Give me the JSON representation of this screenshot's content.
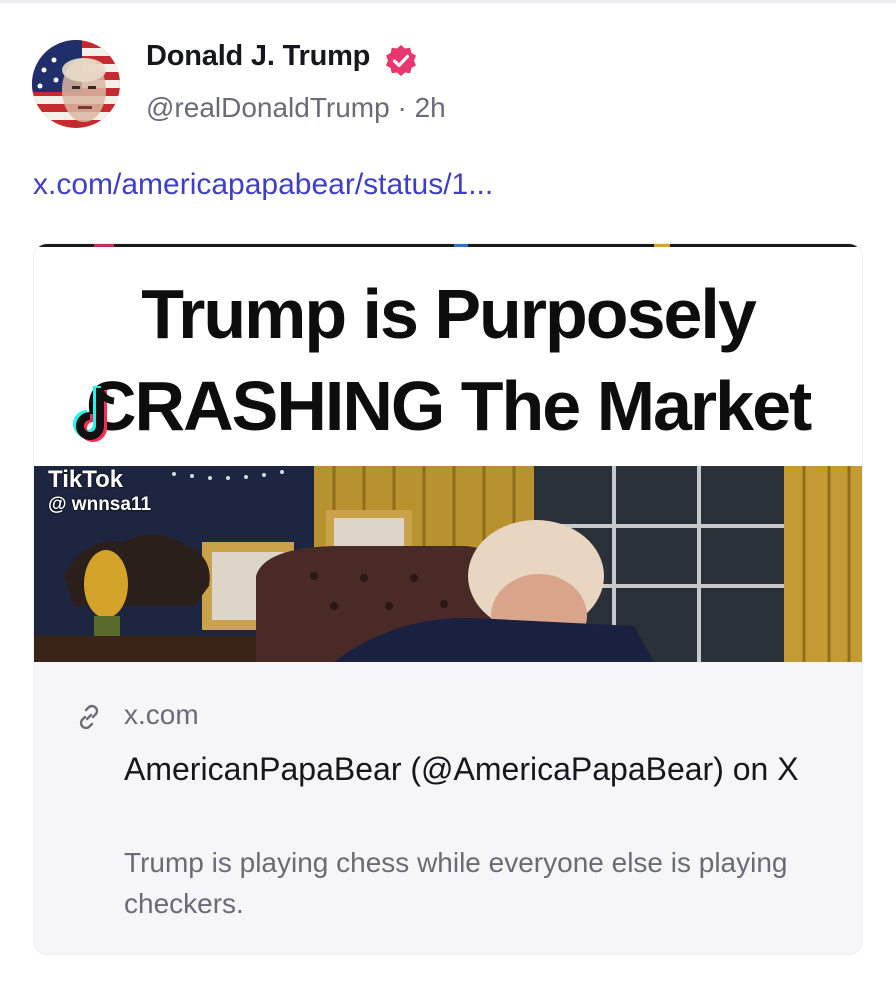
{
  "post": {
    "author": {
      "display_name": "Donald J. Trump",
      "handle": "@realDonaldTrump",
      "separator": "·",
      "time_ago": "2h",
      "verified": true
    },
    "link_text": "x.com/americapapabear/status/1...",
    "link_color": "#3d3fc4",
    "verified_color": "#e8366f"
  },
  "link_card": {
    "image": {
      "headline_line1": "Trump is Purposely",
      "headline_line2": "CRASHING The Market",
      "watermark": "TikTok",
      "watermark_handle": "@ wnnsa11"
    },
    "domain": "x.com",
    "domain_icon": "link-icon",
    "title": "AmericanPapaBear (@AmericaPapaBear) on X",
    "description": "Trump is playing chess while everyone else is playing checkers."
  }
}
